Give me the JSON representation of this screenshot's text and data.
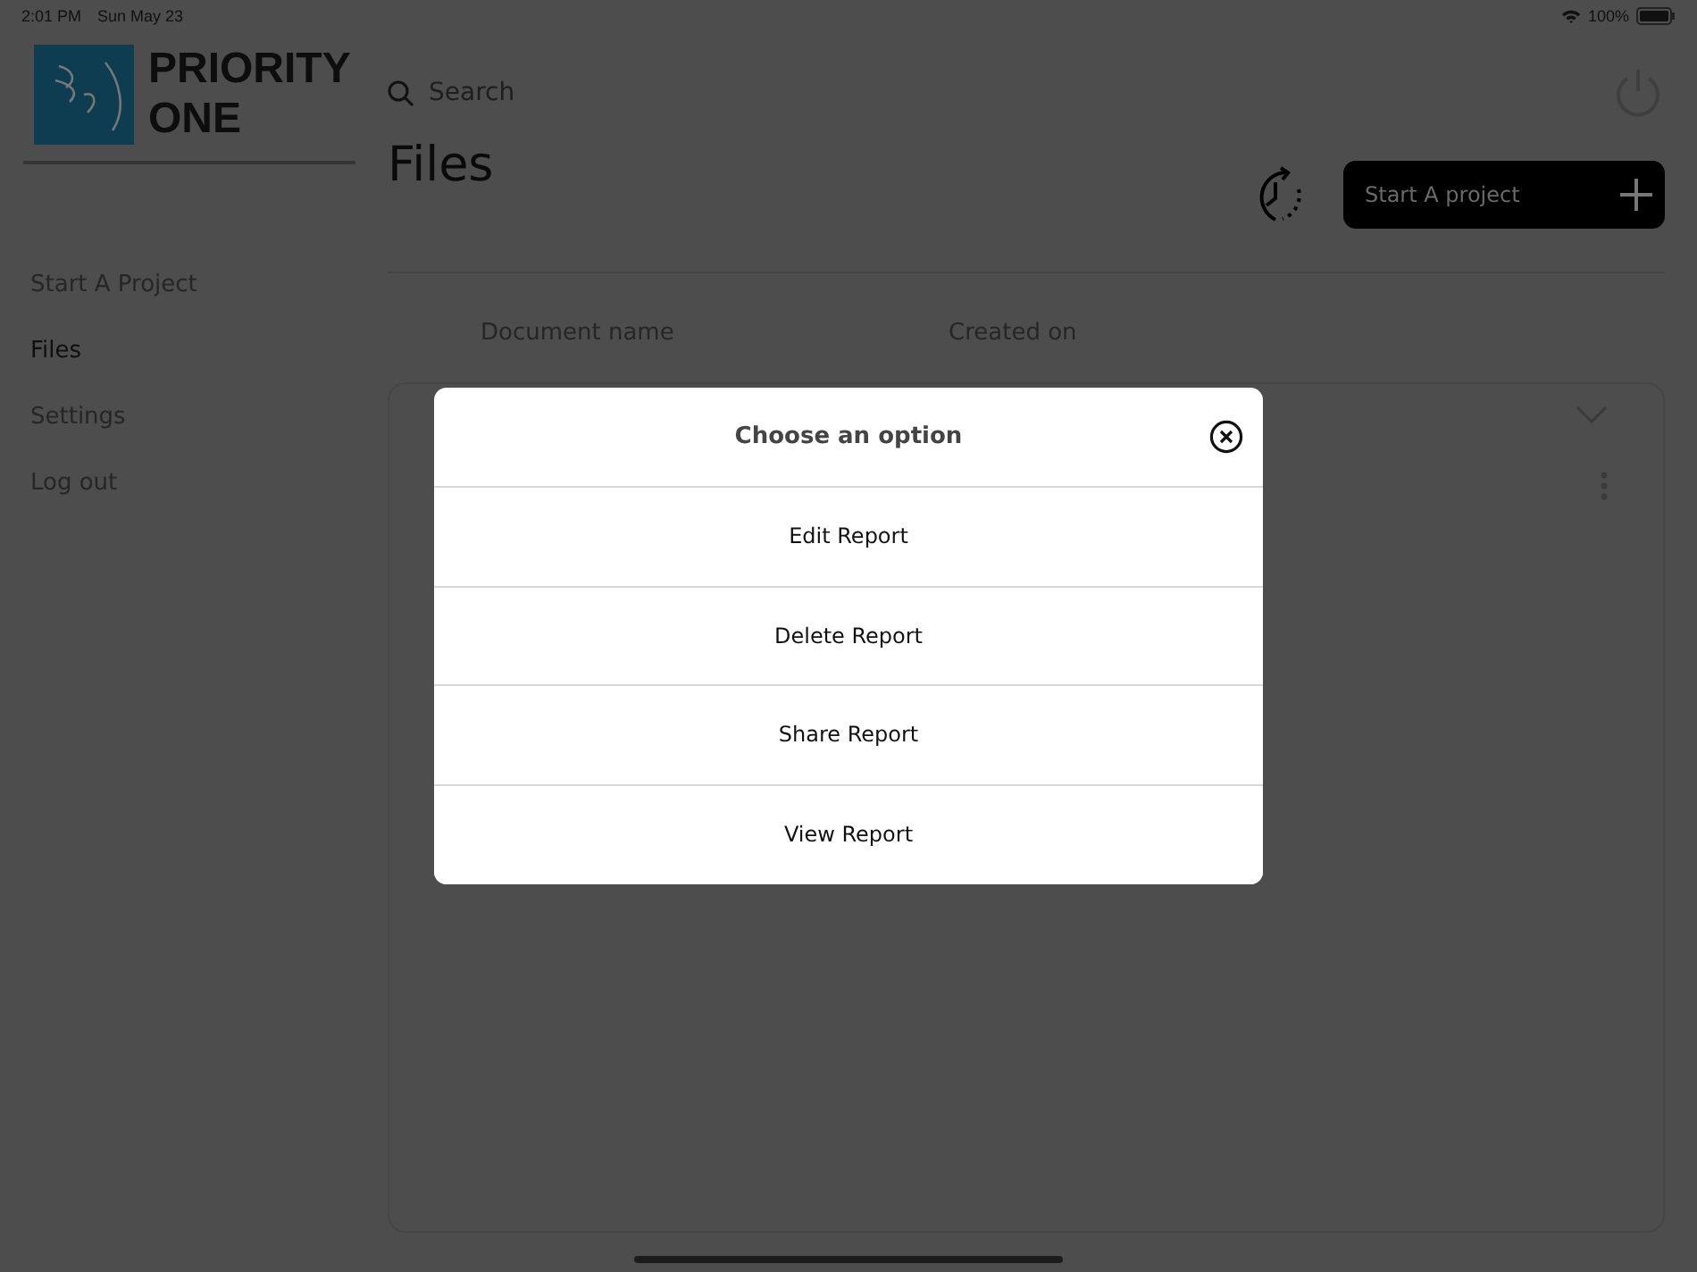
{
  "status_bar": {
    "time": "2:01 PM",
    "date": "Sun May 23",
    "battery": "100%"
  },
  "brand": {
    "line_1": "PRIORITY",
    "line_2": "ONE"
  },
  "sidebar": {
    "items": [
      {
        "label": "Start A Project",
        "selected": false
      },
      {
        "label": "Files",
        "selected": true
      },
      {
        "label": "Settings",
        "selected": false
      },
      {
        "label": "Log out",
        "selected": false
      }
    ]
  },
  "search": {
    "placeholder": "Search"
  },
  "page_title": "Files",
  "start_button": {
    "label": "Start A project"
  },
  "table": {
    "columns": [
      "Document name",
      "Created on"
    ]
  },
  "dialog": {
    "title": "Choose an option",
    "options": [
      "Edit Report",
      "Delete Report",
      "Share Report",
      "View Report"
    ]
  }
}
